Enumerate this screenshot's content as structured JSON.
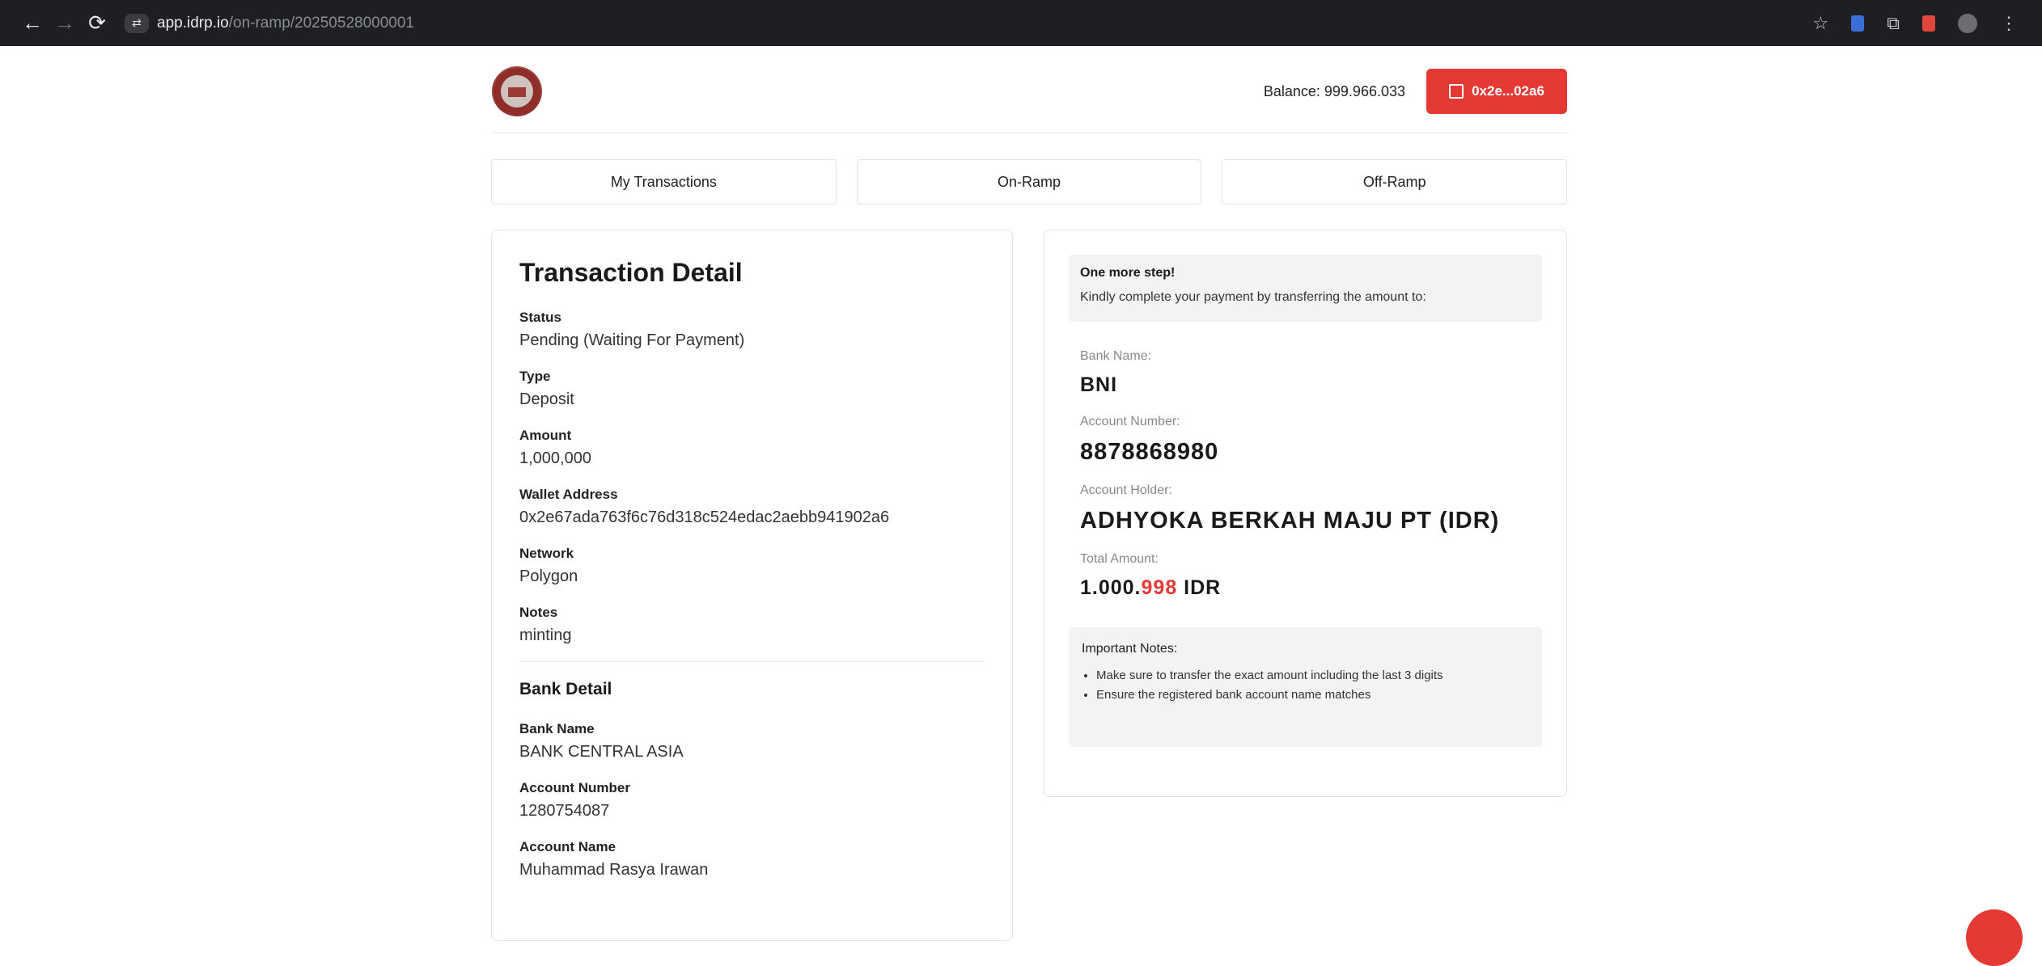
{
  "browser": {
    "url_host": "app.idrp.io",
    "url_path": "/on-ramp/20250528000001"
  },
  "header": {
    "balance_text": "Balance: 999.966.033",
    "wallet_label": "0x2e...02a6"
  },
  "tabs": [
    {
      "label": "My Transactions"
    },
    {
      "label": "On-Ramp"
    },
    {
      "label": "Off-Ramp"
    }
  ],
  "transaction": {
    "title": "Transaction Detail",
    "fields": [
      {
        "label": "Status",
        "value": "Pending (Waiting For Payment)"
      },
      {
        "label": "Type",
        "value": "Deposit"
      },
      {
        "label": "Amount",
        "value": "1,000,000"
      },
      {
        "label": "Wallet Address",
        "value": "0x2e67ada763f6c76d318c524edac2aebb941902a6"
      },
      {
        "label": "Network",
        "value": "Polygon"
      },
      {
        "label": "Notes",
        "value": "minting"
      }
    ],
    "bank_title": "Bank Detail",
    "bank_fields": [
      {
        "label": "Bank Name",
        "value": "BANK CENTRAL ASIA"
      },
      {
        "label": "Account Number",
        "value": "1280754087"
      },
      {
        "label": "Account Name",
        "value": "Muhammad Rasya Irawan"
      }
    ]
  },
  "payment": {
    "step_title": "One more step!",
    "step_text": "Kindly complete your payment by transferring the amount to:",
    "bank_name_label": "Bank Name:",
    "bank_name": "BNI",
    "account_number_label": "Account Number:",
    "account_number": "8878868980",
    "account_holder_label": "Account Holder:",
    "account_holder": "ADHYOKA BERKAH MAJU PT (IDR)",
    "total_label": "Total Amount:",
    "total_prefix": "1.000.",
    "total_highlight": "998",
    "total_currency": " IDR",
    "notes_title": "Important Notes:",
    "notes": [
      "Make sure to transfer the exact amount including the last 3 digits",
      "Ensure the registered bank account name matches"
    ]
  },
  "colors": {
    "accent": "#e53935",
    "chrome_bg": "#1e1f22"
  }
}
